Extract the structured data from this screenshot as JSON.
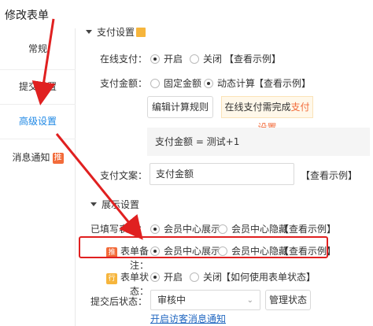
{
  "title": "修改表单",
  "sidebar": {
    "items": [
      {
        "label": "常规"
      },
      {
        "label": "提交设置"
      },
      {
        "label": "高级设置"
      },
      {
        "label": "消息通知",
        "badge": "推"
      }
    ]
  },
  "payment": {
    "section_title": "支付设置",
    "online_label": "在线支付：",
    "online_on": "开启",
    "online_off": "关闭",
    "online_example": "【查看示例】",
    "amount_label": "支付金额：",
    "amount_fixed": "固定金额",
    "amount_dynamic": "动态计算",
    "amount_example": "【查看示例】",
    "edit_rule_button": "编辑计算规则",
    "notice_prefix": "在线支付需完成",
    "notice_link": "支付设置",
    "formula": "支付金额 = 测试+1",
    "text_label": "支付文案：",
    "text_value": "支付金额",
    "text_example": "【查看示例】"
  },
  "display": {
    "section_title": "展示设置",
    "filled_label": "已填写表单：",
    "filled_show": "会员中心展示",
    "filled_hide": "会员中心隐藏",
    "filled_example": "【查看示例】",
    "remark_badge": "推",
    "remark_label": "表单备注：",
    "remark_show": "会员中心展示",
    "remark_hide": "会员中心隐藏",
    "remark_example": "【查看示例】",
    "state_badge": "行",
    "state_label": "表单状态：",
    "state_on": "开启",
    "state_off": "关闭",
    "state_help": "【如何使用表单状态】",
    "after_label": "提交后状态：",
    "after_value": "审核中",
    "manage_button": "管理状态",
    "visitor_link": "开启访客消息通知"
  },
  "colors": {
    "accent": "#1f88e5",
    "highlight": "#e02020",
    "orange": "#f26b3a"
  }
}
